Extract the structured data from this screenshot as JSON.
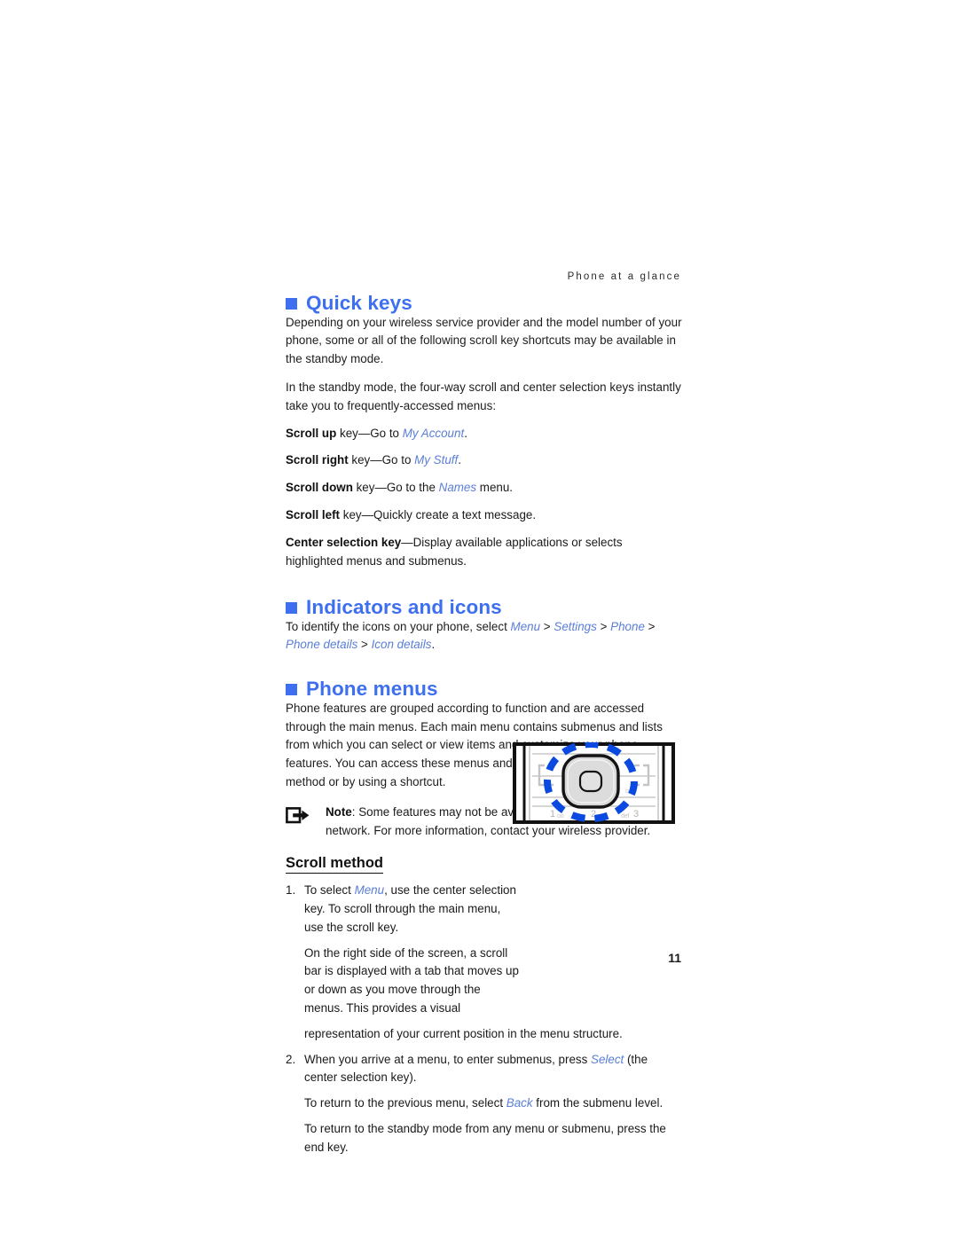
{
  "page": {
    "running_header": "Phone at a glance",
    "folio": "11",
    "accent_heading_color": "#3d6ff0",
    "link_italic_color": "#5a7ed8",
    "text_color": "#1d1d1d"
  },
  "sections": {
    "quick_keys": {
      "heading": "Quick keys",
      "bullet_icon": "blue-square-bullet-icon",
      "paragraph_1": "Depending on your wireless service provider and the model number of your phone, some or all of the following scroll key shortcuts may be available in the standby mode.",
      "paragraph_2": "In the standby mode, the four-way scroll and center selection keys instantly take you to frequently-accessed menus:",
      "key_lines": [
        {
          "key": "Scroll up",
          "before": " key—Go to ",
          "link": "My Account",
          "after": "."
        },
        {
          "key": "Scroll right",
          "before": " key—Go to ",
          "link": "My Stuff",
          "after": "."
        },
        {
          "key": "Scroll down",
          "before": " key—Go to the ",
          "link": "Names",
          "after": " menu."
        },
        {
          "key": "Scroll left",
          "before": " key—Quickly create a text message.",
          "link": "",
          "after": ""
        },
        {
          "key": "Center selection key",
          "before": "—Display available applications or selects highlighted menus and submenus.",
          "link": "",
          "after": ""
        }
      ]
    },
    "indicators_and_icons": {
      "heading": "Indicators and icons",
      "bullet_icon": "blue-square-bullet-icon",
      "intro": "To identify the icons on your phone, select ",
      "path": [
        "Menu",
        "Settings",
        "Phone",
        "Phone details",
        "Icon details"
      ],
      "separator": " > ",
      "terminator": "."
    },
    "phone_menus": {
      "heading": "Phone menus",
      "bullet_icon": "blue-square-bullet-icon",
      "paragraph": "Phone features are grouped according to function and are accessed through the main menus. Each main menu contains submenus and lists from which you can select or view items and customize your phone features. You can access these menus and submenus by using the scroll method or by using a shortcut.",
      "note": {
        "icon": "note-arrow-icon",
        "label": "Note",
        "text": ": Some features may not be available, depending on your network. For more information, contact your wireless provider."
      },
      "scroll_method": {
        "heading": "Scroll method",
        "steps": [
          {
            "number": "1.",
            "paragraphs": [
              {
                "prefix": "To select ",
                "link": "Menu",
                "suffix": ", use the center selection key. To scroll through the main menu, use the scroll key."
              },
              {
                "prefix": "On the right side of the screen, a scroll bar is displayed with a tab that moves up or down as you move through the menus. This provides a visual",
                "link": "",
                "suffix": ""
              },
              {
                "prefix": "representation of your current position in the menu structure.",
                "link": "",
                "suffix": ""
              }
            ]
          },
          {
            "number": "2.",
            "paragraphs": [
              {
                "prefix": "When you arrive at a menu, to enter submenus, press ",
                "link": "Select",
                "suffix": " (the center selection key)."
              },
              {
                "prefix": "To return to the previous menu, select ",
                "link": "Back",
                "suffix": " from the submenu level."
              },
              {
                "prefix": "To return to the standby mode from any menu or submenu, press the end key.",
                "link": "",
                "suffix": ""
              }
            ]
          }
        ],
        "illustration": {
          "icon": "phone-keypad-scroll-key-illustration",
          "highlight_color": "#0a4ae0",
          "keypad_labels": [
            "1",
            "oo",
            "2",
            "abc",
            "3",
            "def"
          ]
        }
      }
    }
  }
}
